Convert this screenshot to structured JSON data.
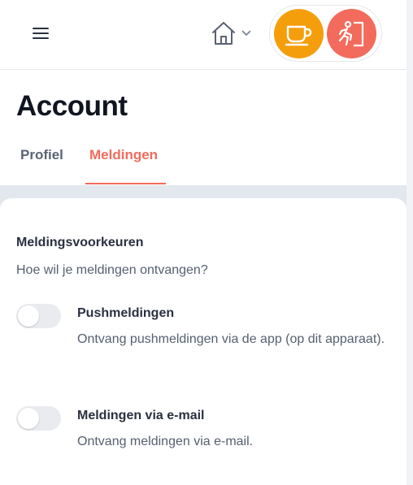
{
  "header": {
    "menu_icon": "hamburger-menu-icon",
    "home_icon": "home-icon",
    "home_chevron_icon": "chevron-down-icon",
    "coffee_button": {
      "icon": "coffee-cup-icon",
      "color": "#f59e0b"
    },
    "exit_button": {
      "icon": "walk-out-door-icon",
      "color": "#f36b5c"
    }
  },
  "page": {
    "title": "Account",
    "tabs": [
      {
        "label": "Profiel",
        "active": false
      },
      {
        "label": "Meldingen",
        "active": true
      }
    ],
    "accent_color": "#f36b5c"
  },
  "notifications": {
    "section_title": "Meldingsvoorkeuren",
    "section_subtitle": "Hoe wil je meldingen ontvangen?",
    "options": [
      {
        "title": "Pushmeldingen",
        "description": "Ontvang pushmeldingen via de app (op dit apparaat).",
        "enabled": false
      },
      {
        "title": "Meldingen via e-mail",
        "description": "Ontvang meldingen via e-mail.",
        "enabled": false
      }
    ]
  }
}
